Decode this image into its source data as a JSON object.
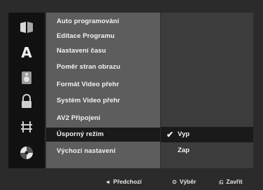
{
  "sidebar": {
    "icons": [
      {
        "name": "disc-menu-icon"
      },
      {
        "name": "language-icon",
        "glyph": "A"
      },
      {
        "name": "audio-icon"
      },
      {
        "name": "lock-icon"
      },
      {
        "name": "recording-icon"
      },
      {
        "name": "disc-icon"
      }
    ]
  },
  "menu": {
    "items": [
      {
        "label": "Auto programování"
      },
      {
        "label": "Editace Programu"
      },
      {
        "label": "Nastavení času"
      },
      {
        "label": "Poměr stran obrazu"
      },
      {
        "label": "Formát Video přehr"
      },
      {
        "label": "Systém Video přehr"
      },
      {
        "label": "AV2 Připojení"
      },
      {
        "label": "Úsporný režim"
      },
      {
        "label": "Výchozí nastavení"
      }
    ],
    "selected_index": 7
  },
  "options": {
    "items": [
      {
        "label": "Vyp",
        "checked": true
      },
      {
        "label": "Zap",
        "checked": false
      }
    ],
    "check_glyph": "✔"
  },
  "hints": {
    "back": {
      "icon": "◄",
      "label": "Předchozí"
    },
    "select": {
      "icon": "⊙",
      "label": "Výběr"
    },
    "close": {
      "icon": "⎌",
      "label": "Zavřít"
    }
  },
  "colors": {
    "background": "#2b2b2b",
    "sidebar": "#111111",
    "menu_panel": "#5d5d5d",
    "options_panel": "#3c3c3c",
    "selection": "#1a1a1a",
    "text": "#f4f4f4"
  }
}
